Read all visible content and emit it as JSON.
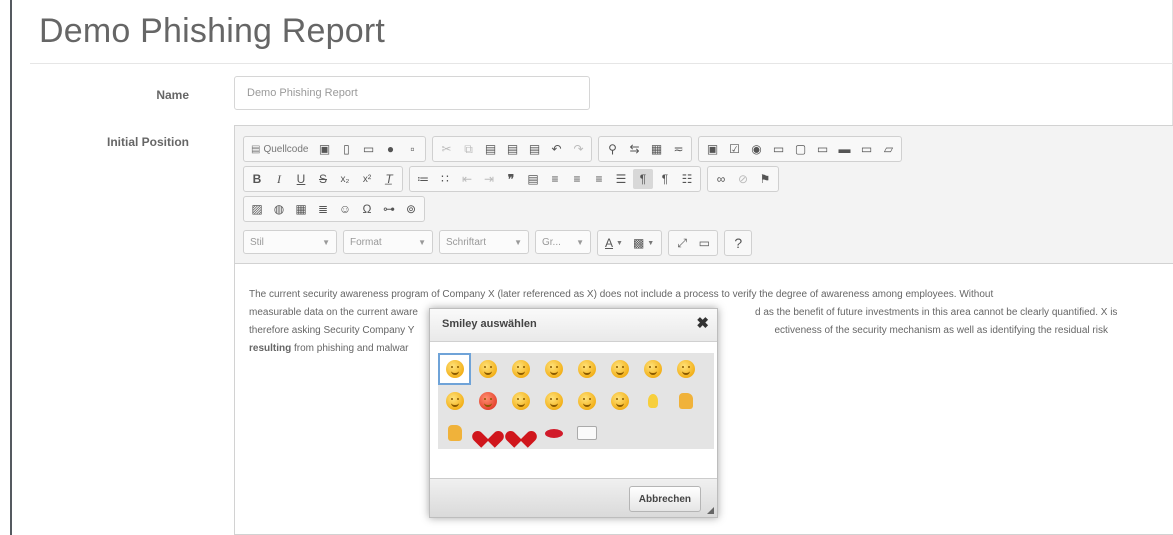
{
  "page": {
    "title": "Demo Phishing Report"
  },
  "form": {
    "name_label": "Name",
    "name_value": "Demo Phishing Report",
    "position_label": "Initial Position"
  },
  "toolbar": {
    "source_label": "Quellcode",
    "style_combo": "Stil",
    "format_combo": "Format",
    "font_combo": "Schriftart",
    "size_combo": "Gr...",
    "text_color_label": "A",
    "help_label": "?"
  },
  "content": {
    "text_1": "The current security awareness program of Company X (later referenced as X) does not include a process to verify the degree of awareness among employees. Without",
    "text_2a": "measurable data on the current aware",
    "text_2b": "d as the benefit of future investments in this area cannot be clearly quantified. X is",
    "text_3a": "therefore asking Security Company Y",
    "text_3b": "ectiveness of the security mechanism as well as identifying the residual risk",
    "bold_word": "resulting",
    "text_4": "from phishing and malwar"
  },
  "dialog": {
    "title": "Smiley auswählen",
    "close": "✖",
    "cancel_button": "Abbrechen",
    "smileys": [
      {
        "icon": "smiley-icon",
        "type": "face"
      },
      {
        "icon": "sad-smiley-icon",
        "type": "face"
      },
      {
        "icon": "wink-smiley-icon",
        "type": "face"
      },
      {
        "icon": "laughing-smiley-icon",
        "type": "face"
      },
      {
        "icon": "frown-smiley-icon",
        "type": "face"
      },
      {
        "icon": "tongue-smiley-icon",
        "type": "face"
      },
      {
        "icon": "embarrassed-smiley-icon",
        "type": "face"
      },
      {
        "icon": "surprised-smiley-icon",
        "type": "face"
      },
      {
        "icon": "indecision-smiley-icon",
        "type": "face"
      },
      {
        "icon": "angry-smiley-icon",
        "type": "face-red"
      },
      {
        "icon": "angel-smiley-icon",
        "type": "face"
      },
      {
        "icon": "cool-smiley-icon",
        "type": "face"
      },
      {
        "icon": "devil-smiley-icon",
        "type": "face"
      },
      {
        "icon": "crying-smiley-icon",
        "type": "face"
      },
      {
        "icon": "lightbulb-icon",
        "type": "bulb"
      },
      {
        "icon": "thumbs-down-icon",
        "type": "thumb"
      },
      {
        "icon": "thumbs-up-icon",
        "type": "thumb"
      },
      {
        "icon": "heart-icon",
        "type": "heart"
      },
      {
        "icon": "broken-heart-icon",
        "type": "heart"
      },
      {
        "icon": "kiss-icon",
        "type": "lips"
      },
      {
        "icon": "envelope-icon",
        "type": "envelope"
      }
    ]
  }
}
